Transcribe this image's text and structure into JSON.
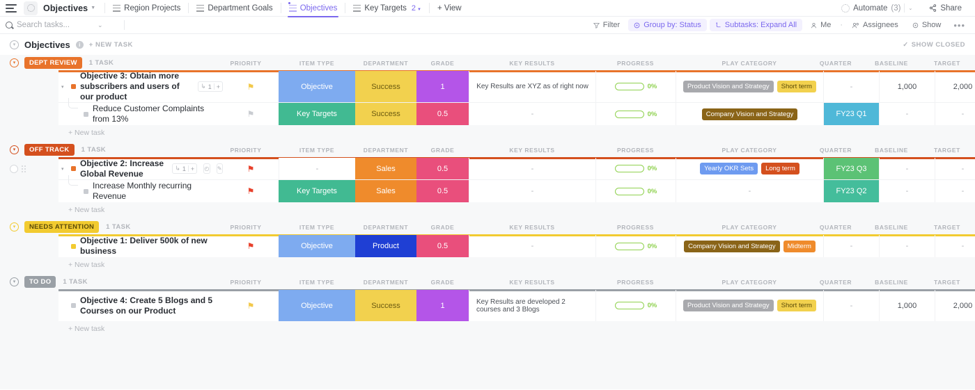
{
  "topbar": {
    "space_icon": "dotted-circle-icon",
    "view_title": "Objectives",
    "tabs": [
      {
        "label": "Region Projects",
        "active": false,
        "icon": "list-icon"
      },
      {
        "label": "Department Goals",
        "active": false,
        "icon": "list-icon"
      },
      {
        "label": "Objectives",
        "active": true,
        "icon": "list-icon-badge"
      },
      {
        "label": "Key Targets",
        "active": false,
        "icon": "list-icon",
        "count": "2"
      }
    ],
    "add_view_label": "+ View",
    "automate_label": "Automate",
    "automate_count": "(3)",
    "share_label": "Share"
  },
  "filterbar": {
    "search_placeholder": "Search tasks...",
    "search_value": "",
    "filter_label": "Filter",
    "group_by_label": "Group by: Status",
    "subtasks_label": "Subtasks: Expand All",
    "me_label": "Me",
    "assignees_label": "Assignees",
    "show_label": "Show",
    "more_label": "•••"
  },
  "page": {
    "title": "Objectives",
    "new_task_label": "+ NEW TASK",
    "show_closed_label": "SHOW CLOSED"
  },
  "columns": [
    {
      "key": "priority",
      "label": "PRIORITY"
    },
    {
      "key": "item_type",
      "label": "ITEM TYPE"
    },
    {
      "key": "department",
      "label": "DEPARTMENT"
    },
    {
      "key": "grade",
      "label": "GRADE"
    },
    {
      "key": "key_results",
      "label": "KEY RESULTS"
    },
    {
      "key": "progress",
      "label": "PROGRESS"
    },
    {
      "key": "play_category",
      "label": "PLAY CATEGORY"
    },
    {
      "key": "quarter",
      "label": "QUARTER"
    },
    {
      "key": "baseline",
      "label": "BASELINE"
    },
    {
      "key": "target",
      "label": "TARGET"
    }
  ],
  "groups": [
    {
      "status": "DEPT REVIEW",
      "status_color": "#e8732b",
      "task_count": "1 TASK",
      "new_task_label": "+ New task",
      "tasks": [
        {
          "name": "Objective 3: Obtain more subscribers and users of our product",
          "is_sub": false,
          "dot_color": "#e8732b",
          "subtask_count": "1",
          "priority_flag": "#f2c94c",
          "item_type": "Objective",
          "item_type_color": "#7eabf0",
          "department": "Success",
          "department_color": "#f2d14e",
          "department_text": "#6b5a10",
          "grade": "1",
          "grade_color": "#b455e8",
          "key_results": "Key Results are XYZ as of right now",
          "progress": "0%",
          "play_category": [
            {
              "label": "Product Vision and Strategy",
              "color": "#a8a9ad"
            },
            {
              "label": "Short term",
              "color": "#f2d14e",
              "text": "#5a4a08"
            }
          ],
          "quarter": "-",
          "quarter_color": "",
          "baseline": "1,000",
          "target": "2,000"
        },
        {
          "name": "Reduce Customer Complaints from 13%",
          "is_sub": true,
          "priority_flag": "#c9ccd1",
          "item_type": "Key Targets",
          "item_type_color": "#41ba92",
          "department": "Success",
          "department_color": "#f2d14e",
          "department_text": "#6b5a10",
          "grade": "0.5",
          "grade_color": "#e94f7c",
          "key_results": "-",
          "progress": "0%",
          "play_category": [
            {
              "label": "Company Vision and Strategy",
              "color": "#8a6418"
            }
          ],
          "quarter": "FY23 Q1",
          "quarter_color": "#4fb8d8",
          "baseline": "-",
          "target": "-"
        }
      ]
    },
    {
      "status": "OFF TRACK",
      "status_color": "#d4501e",
      "task_count": "1 TASK",
      "new_task_label": "+ New task",
      "tasks": [
        {
          "name": "Objective 2: Increase Global Revenue",
          "is_sub": false,
          "dot_color": "#e8732b",
          "subtask_count": "1",
          "priority_flag": "#e8412c",
          "item_type": "-",
          "item_type_color": "",
          "department": "Sales",
          "department_color": "#ef8b2c",
          "department_text": "#ffffff",
          "grade": "0.5",
          "grade_color": "#e94f7c",
          "key_results": "-",
          "progress": "0%",
          "play_category": [
            {
              "label": "Yearly OKR Sets",
              "color": "#6e9bf0"
            },
            {
              "label": "Long term",
              "color": "#d4501e"
            }
          ],
          "quarter": "FY23 Q3",
          "quarter_color": "#5cc275",
          "baseline": "-",
          "target": "-"
        },
        {
          "name": "Increase Monthly recurring Revenue",
          "is_sub": true,
          "priority_flag": "#e8412c",
          "item_type": "Key Targets",
          "item_type_color": "#41ba92",
          "department": "Sales",
          "department_color": "#ef8b2c",
          "department_text": "#ffffff",
          "grade": "0.5",
          "grade_color": "#e94f7c",
          "key_results": "-",
          "progress": "0%",
          "play_category": [],
          "quarter": "FY23 Q2",
          "quarter_color": "#44bd9b",
          "baseline": "-",
          "target": "-"
        }
      ]
    },
    {
      "status": "NEEDS ATTENTION",
      "status_color": "#f2cb30",
      "status_text": "#5a4a08",
      "task_count": "1 TASK",
      "new_task_label": "+ New task",
      "tasks": [
        {
          "name": "Objective 1: Deliver 500k of new business",
          "is_sub": false,
          "dot_color": "#f2cb30",
          "priority_flag": "#e8412c",
          "item_type": "Objective",
          "item_type_color": "#7eabf0",
          "department": "Product",
          "department_color": "#1f3fd4",
          "department_text": "#ffffff",
          "grade": "0.5",
          "grade_color": "#e94f7c",
          "key_results": "-",
          "progress": "0%",
          "play_category": [
            {
              "label": "Company Vision and Strategy",
              "color": "#8a6418"
            },
            {
              "label": "Midterm",
              "color": "#ef8b2c"
            }
          ],
          "quarter": "-",
          "quarter_color": "",
          "baseline": "-",
          "target": "-"
        }
      ]
    },
    {
      "status": "TO DO",
      "status_color": "#9aa0a6",
      "task_count": "1 TASK",
      "new_task_label": "+ New task",
      "tasks": [
        {
          "name": "Objective 4: Create 5 Blogs and 5 Courses on our Product",
          "is_sub": false,
          "dot_color": "#c9ccd1",
          "priority_flag": "#f2c94c",
          "item_type": "Objective",
          "item_type_color": "#7eabf0",
          "department": "Success",
          "department_color": "#f2d14e",
          "department_text": "#6b5a10",
          "grade": "1",
          "grade_color": "#b455e8",
          "key_results": "Key Results are developed 2 courses and 3 Blogs",
          "progress": "0%",
          "play_category": [
            {
              "label": "Product Vision and Strategy",
              "color": "#a8a9ad"
            },
            {
              "label": "Short term",
              "color": "#f2d14e",
              "text": "#5a4a08"
            }
          ],
          "quarter": "-",
          "quarter_color": "",
          "baseline": "1,000",
          "target": "2,000"
        }
      ]
    }
  ]
}
